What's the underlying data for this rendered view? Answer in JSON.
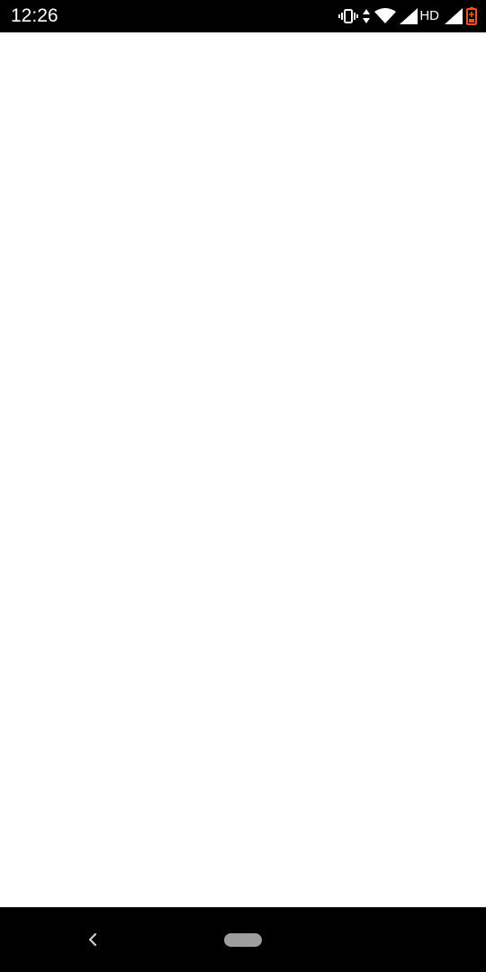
{
  "status_bar": {
    "time": "12:26",
    "network_label": "HD",
    "icons": [
      "vibrate-icon",
      "data-arrows-icon",
      "wifi-icon",
      "signal-icon",
      "signal-icon",
      "battery-charging-icon"
    ],
    "battery_color": "#f4511e"
  },
  "navigation_bar": {
    "buttons": [
      "back-icon",
      "home-pill"
    ]
  }
}
